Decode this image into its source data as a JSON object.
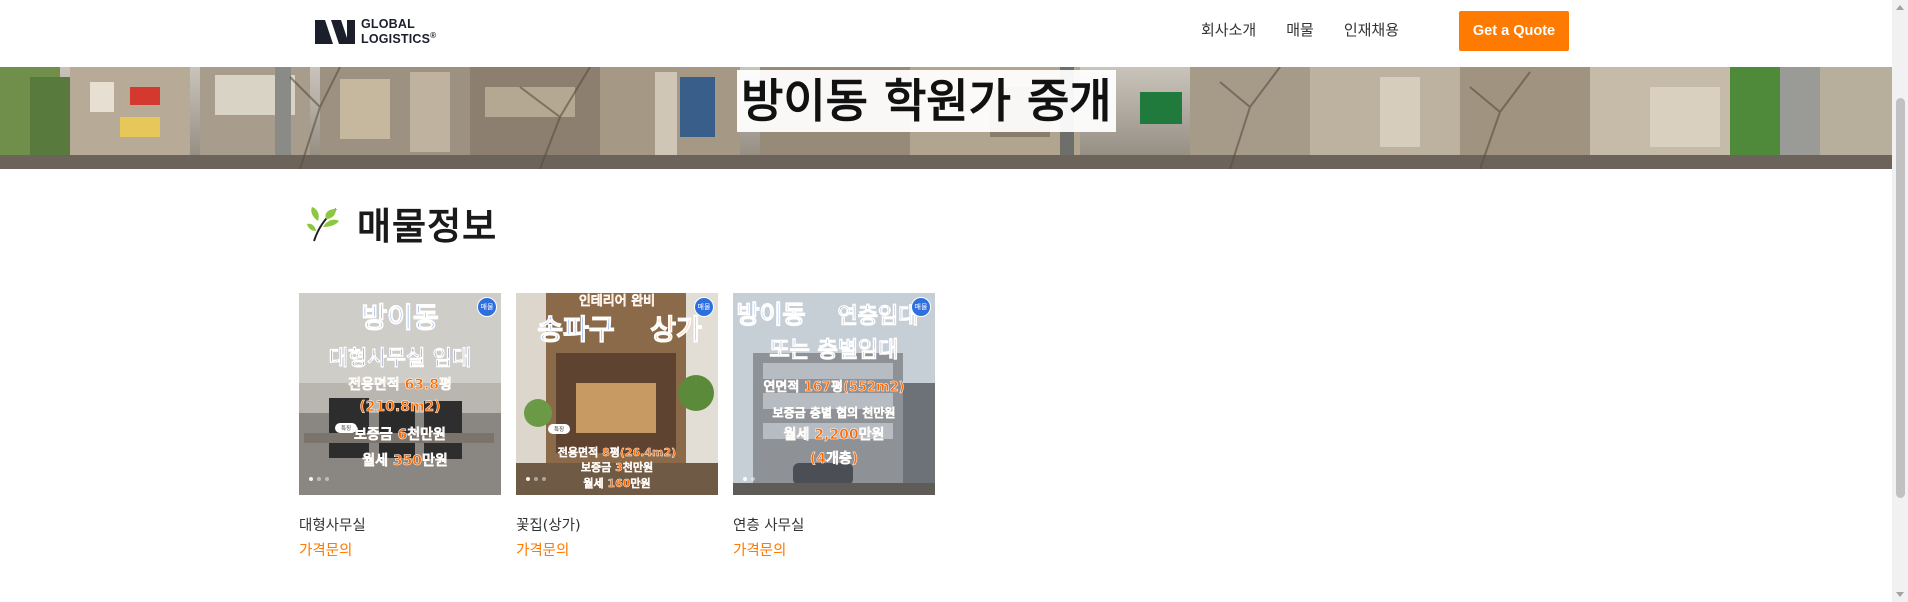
{
  "header": {
    "logo": {
      "line1": "GLOBAL",
      "line2": "LOGISTICS",
      "mark": "®"
    },
    "nav": [
      "회사소개",
      "매물",
      "인재채용"
    ],
    "cta_label": "Get a Quote"
  },
  "hero": {
    "title": "방이동 학원가 중개"
  },
  "section": {
    "icon": "leaf-icon",
    "title": "매물정보"
  },
  "listings": [
    {
      "name": "대형사무실",
      "price": "가격문의",
      "badge": "매물",
      "tag": "특징",
      "image_text": [
        "방이동",
        "대형사무실 임대",
        "전용면적 63.8평",
        "(210.8m2)",
        "보증금 6천만원",
        "월세 350만원"
      ]
    },
    {
      "name": "꽃집(상가)",
      "price": "가격문의",
      "badge": "매물",
      "tag": "특징",
      "image_text": [
        "인테리어 완비",
        "송파구",
        "상가",
        "전용면적 8평(26.4m2)",
        "보증금 3천만원",
        "월세 160만원"
      ]
    },
    {
      "name": "연층 사무실",
      "price": "가격문의",
      "badge": "매물",
      "image_text": [
        "방이동",
        "연층임대",
        "또는 층별임대",
        "연면적 167평(552m2)",
        "보증금 층별 협의 천만원",
        "월세 2,200만원",
        "(4개층)"
      ]
    }
  ],
  "colors": {
    "accent": "#ff7a00",
    "badge": "#2e6fe0",
    "headline_blue": "#1f63e6",
    "headline_orange": "#ff6a00"
  }
}
